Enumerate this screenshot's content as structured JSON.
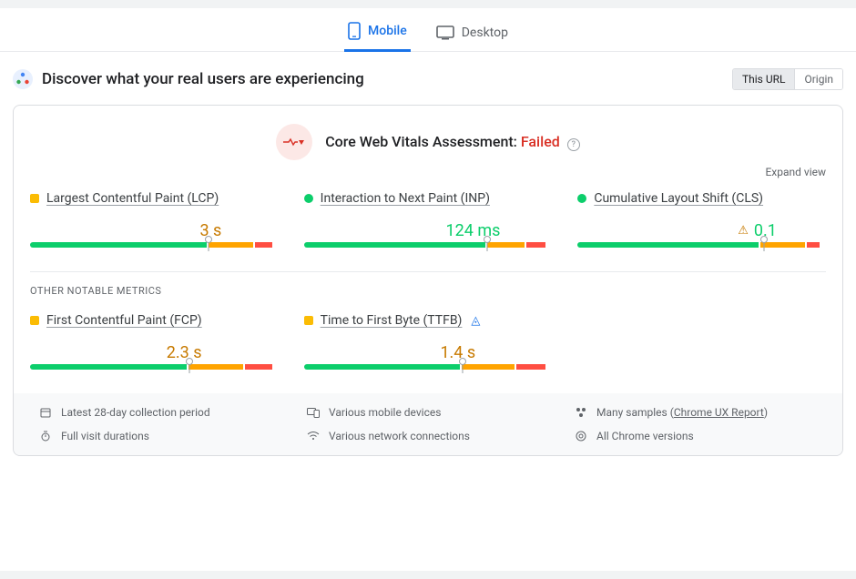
{
  "tabs": {
    "mobile": "Mobile",
    "desktop": "Desktop"
  },
  "header": {
    "title": "Discover what your real users are experiencing"
  },
  "toggle": {
    "url": "This URL",
    "origin": "Origin"
  },
  "assessment": {
    "label": "Core Web Vitals Assessment: ",
    "status": "Failed"
  },
  "expand": "Expand view",
  "core_metrics": [
    {
      "name": "Largest Contentful Paint (LCP)",
      "status": "orange",
      "value": "3 s",
      "marker": 72,
      "segments": [
        71,
        2,
        18,
        2,
        7
      ],
      "value_right": 28,
      "warn": false
    },
    {
      "name": "Interaction to Next Paint (INP)",
      "status": "green",
      "value": "124 ms",
      "marker": 74,
      "segments": [
        73,
        2,
        15,
        2,
        8
      ],
      "value_right": 26,
      "warn": false
    },
    {
      "name": "Cumulative Layout Shift (CLS)",
      "status": "green",
      "value": "0.1",
      "marker": 75,
      "segments": [
        73,
        2,
        18,
        2,
        5
      ],
      "value_right": 25,
      "warn": true
    }
  ],
  "other_label": "Other Notable Metrics",
  "other_metrics": [
    {
      "name": "First Contentful Paint (FCP)",
      "status": "orange",
      "value": "2.3 s",
      "marker": 64,
      "segments": [
        63,
        2,
        22,
        2,
        11
      ],
      "value_right": 36,
      "info": false
    },
    {
      "name": "Time to First Byte (TTFB)",
      "status": "orange",
      "value": "1.4 s",
      "marker": 64,
      "segments": [
        63,
        2,
        21,
        2,
        12
      ],
      "value_right": 36,
      "info": true
    }
  ],
  "footer": {
    "period": "Latest 28-day collection period",
    "devices": "Various mobile devices",
    "samples_prefix": "Many samples (",
    "samples_link": "Chrome UX Report",
    "samples_suffix": ")",
    "durations": "Full visit durations",
    "network": "Various network connections",
    "versions": "All Chrome versions"
  }
}
